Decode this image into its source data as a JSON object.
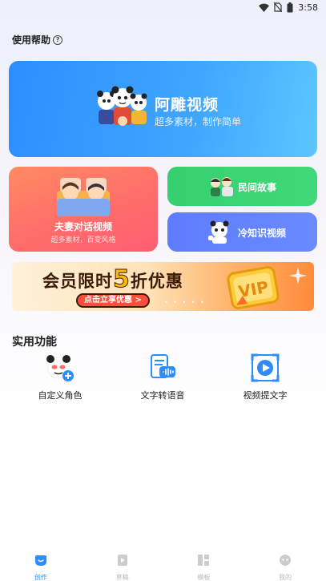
{
  "status_bar": {
    "time": "3:58"
  },
  "help": {
    "label": "使用帮助",
    "icon": "question-circle-icon"
  },
  "hero_card": {
    "title": "阿雕视频",
    "subtitle": "超多素材，制作简单"
  },
  "couple_card": {
    "title": "夫妻对话视频",
    "subtitle": "超多素材，百变风格"
  },
  "folk_card": {
    "title": "民间故事"
  },
  "cold_card": {
    "title": "冷知识视频"
  },
  "banner": {
    "title_prefix": "会员限时",
    "title_number": "5",
    "title_suffix": "折优惠",
    "button": "点击立享优惠 >",
    "badge": "VIP"
  },
  "tools": {
    "title": "实用功能",
    "items": [
      {
        "label": "自定义角色",
        "icon": "panda-add-icon"
      },
      {
        "label": "文字转语音",
        "icon": "text-to-speech-icon"
      },
      {
        "label": "视频提文字",
        "icon": "video-extract-icon"
      }
    ]
  },
  "tabbar": {
    "items": [
      {
        "label": "创作",
        "icon": "create-icon",
        "active": true
      },
      {
        "label": "草稿",
        "icon": "draft-icon",
        "active": false
      },
      {
        "label": "模板",
        "icon": "template-icon",
        "active": false
      },
      {
        "label": "我的",
        "icon": "profile-icon",
        "active": false
      }
    ]
  },
  "colors": {
    "accent": "#2d8dff",
    "hero": "#3fa6ff",
    "couple": "#ff6b6b",
    "folk": "#3fd97a",
    "cold": "#6a8bff",
    "banner_text": "#3b1c08"
  }
}
